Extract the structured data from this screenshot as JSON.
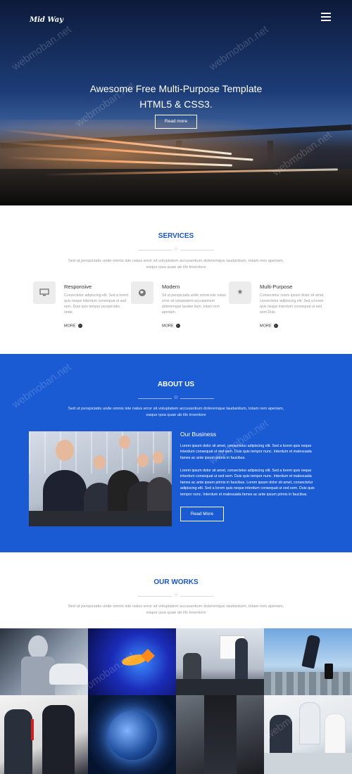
{
  "header": {
    "logo": "Mid Way",
    "menu_icon": "hamburger-menu-icon"
  },
  "hero": {
    "title_line1": "Awesome Free Multi-Purpose Template",
    "title_line2": "HTML5 & CSS3.",
    "button_label": "Read more"
  },
  "services": {
    "title": "SERVICES",
    "divider_icon": "star-icon",
    "description": "Sed ut perspiciatis unde omnis iste natus error sit voluptatem accusantium doloremque laudantium, totam rem aperiam, eaque ipsa quae ab illo inventore",
    "features": [
      {
        "icon": "monitor-icon",
        "name": "Responsive",
        "text": "Consectetur adipiscing elit. Sed a lorem quis neque interdum consequat ut sed sem. Duis quis tempor perspiciatis unde.",
        "more": "MORE"
      },
      {
        "icon": "globe-icon",
        "name": "Modern",
        "text": "Sit ut perspiciatis unde omnis iste natus error sit voluptatem accusantium doloremque laudan tium, totam rem aperiam.",
        "more": "MORE"
      },
      {
        "icon": "star-icon",
        "name": "Multi-Purpose",
        "text": "Consectetur lorem ipsum dolor sit amet, consectetur adipiscing elit. Sed a lorem quis neque interdum consequat ut sed sem Duis.",
        "more": "MORE"
      }
    ]
  },
  "about": {
    "title": "ABOUT US",
    "divider_icon": "star-icon",
    "description": "Sed ut perspiciatis unde omnis iste natus error sit voluptatem accusantium doloremque laudantium, totam rem aperiam, eaque ipsa quae ab illo inventore",
    "business_heading": "Our Business",
    "paragraph1": "Lorem ipsum dolor sit amet, consectetur adipiscing elit. Sed a lorem quis neque interdum consequat ut sed sem. Duis quis tempor nunc. Interdum et malesuada fames ac ante ipsum primis in faucibus.",
    "paragraph2": "Lorem ipsum dolor sit amet, consectetur adipiscing elit. Sed a lorem quis neque interdum consequat ut sed sem. Duis quis tempor nunc. Interdum et malesuada fames ac ante ipsum primis in faucibus. Lorem ipsum dolor sit amet, consectetur adipiscing elit. Sed a lorem quis neque interdum consequat ut sed sem. Duis quis tempor nunc. Interdum et malesuada fames ac ante ipsum primis in faucibus.",
    "button_label": "Read More"
  },
  "works": {
    "title": "OUR WORKS",
    "divider_icon": "star-icon",
    "description": "Sed ut perspiciatis unde omnis iste natus error sit voluptatem accusantium doloremque laudantium, totam rem aperiam, eaque ipsa quae ab illo inventore"
  },
  "colors": {
    "accent": "#1a5bd4",
    "heading_blue": "#1a55c9"
  },
  "watermark": "webmoban.net"
}
